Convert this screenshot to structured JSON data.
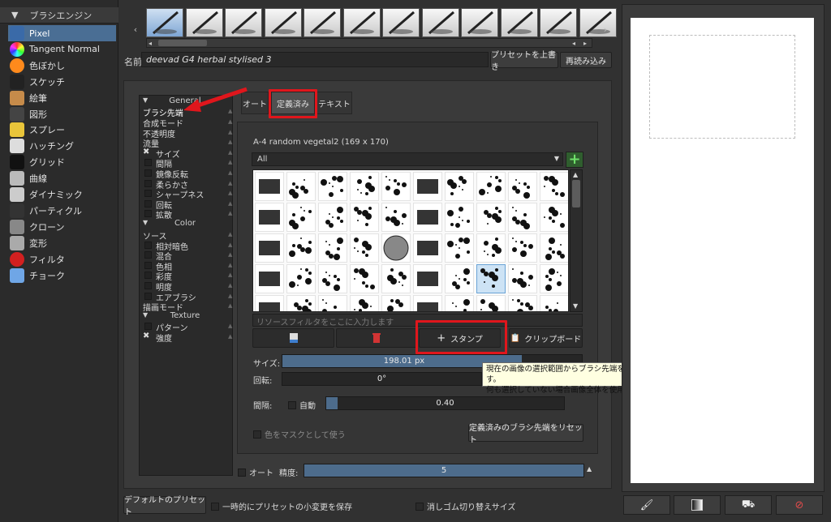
{
  "engine": {
    "header": "ブラシエンジン",
    "items": [
      {
        "label": "Pixel",
        "icon": "pencil-icon",
        "color": "#3a6aa8"
      },
      {
        "label": "Tangent Normal",
        "icon": "color-sphere-icon",
        "color": "#8a6cff"
      },
      {
        "label": "色ぼかし",
        "icon": "color-blend-icon",
        "color": "#ff8a1c"
      },
      {
        "label": "スケッチ",
        "icon": "sketch-pen-icon",
        "color": "#222222"
      },
      {
        "label": "絵筆",
        "icon": "paint-brush-icon",
        "color": "#c68b4a"
      },
      {
        "label": "図形",
        "icon": "shape-dots-icon",
        "color": "#444444"
      },
      {
        "label": "スプレー",
        "icon": "spray-can-icon",
        "color": "#e9c53a"
      },
      {
        "label": "ハッチング",
        "icon": "hatching-icon",
        "color": "#dddddd"
      },
      {
        "label": "グリッド",
        "icon": "grid-dots-icon",
        "color": "#111111"
      },
      {
        "label": "曲線",
        "icon": "curve-icon",
        "color": "#bbbbbb"
      },
      {
        "label": "ダイナミック",
        "icon": "dynamic-icon",
        "color": "#cccccc"
      },
      {
        "label": "パーティクル",
        "icon": "particle-icon",
        "color": "#333333"
      },
      {
        "label": "クローン",
        "icon": "clone-stamp-icon",
        "color": "#888888"
      },
      {
        "label": "変形",
        "icon": "deform-swirl-icon",
        "color": "#aaaaaa"
      },
      {
        "label": "フィルタ",
        "icon": "filter-ball-icon",
        "color": "#d22020"
      },
      {
        "label": "チョーク",
        "icon": "chalk-icon",
        "color": "#6fa6e6"
      }
    ]
  },
  "presets": {
    "name_label": "名前:",
    "name_value": "deevad G4 herbal stylised 3",
    "overwrite_button": "プリセットを上書き",
    "reload_button": "再読み込み"
  },
  "options": {
    "general_header": "General",
    "general": [
      {
        "label": "ブラシ先端",
        "indent": 0
      },
      {
        "label": "合成モード",
        "indent": 0
      },
      {
        "label": "不透明度",
        "indent": 0
      },
      {
        "label": "流量",
        "indent": 0
      },
      {
        "label": "サイズ",
        "indent": 0,
        "checked": true
      },
      {
        "label": "間隔",
        "indent": 1
      },
      {
        "label": "鏡像反転",
        "indent": 1
      },
      {
        "label": "柔らかさ",
        "indent": 1
      },
      {
        "label": "シャープネス",
        "indent": 1
      },
      {
        "label": "回転",
        "indent": 1
      },
      {
        "label": "拡散",
        "indent": 1
      }
    ],
    "color_header": "Color",
    "color": [
      {
        "label": "ソース",
        "indent": 0
      },
      {
        "label": "相対暗色",
        "indent": 1
      },
      {
        "label": "混合",
        "indent": 1
      },
      {
        "label": "色相",
        "indent": 1
      },
      {
        "label": "彩度",
        "indent": 1
      },
      {
        "label": "明度",
        "indent": 1
      },
      {
        "label": "エアブラシ",
        "indent": 1
      },
      {
        "label": "描画モード",
        "indent": 0
      }
    ],
    "texture_header": "Texture",
    "texture": [
      {
        "label": "パターン",
        "indent": 1
      },
      {
        "label": "強度",
        "indent": 0,
        "checked": true
      }
    ]
  },
  "tabs": [
    "オート",
    "定義済み",
    "テキスト"
  ],
  "tip": {
    "title": "A-4 random vegetal2 (169 x 170)",
    "filter_value": "All",
    "filter_placeholder": "リソースフィルタをここに入力します",
    "stamp_button": "スタンプ",
    "clipboard_button": "クリップボード",
    "size_label": "サイズ:",
    "size_value": "198.01 px",
    "size_fraction": 0.8,
    "rotation_label": "回転:",
    "rotation_value": "0°",
    "spacing_label": "間隔:",
    "spacing_auto": "自動",
    "spacing_value": "0.40",
    "mask_label": "色をマスクとして使う",
    "reset_button": "定義済みのブラシ先端をリセット",
    "tooltip_line1": "現在の画像の選択範囲からブラシ先端を作成します。",
    "tooltip_line2": "何も選択していない場合画像全体を使用します。",
    "auto_label": "オート",
    "precision_label": "精度:",
    "precision_value": "5"
  },
  "footer": {
    "default_preset_button": "デフォルトのプリセット",
    "temp_save_label": "一時的にプリセットの小変更を保存",
    "eraser_switch_label": "消しゴム切り替えサイズ"
  },
  "preview_buttons": [
    "brush-icon",
    "gradient-icon",
    "fill-bucket-icon",
    "clear-icon"
  ]
}
